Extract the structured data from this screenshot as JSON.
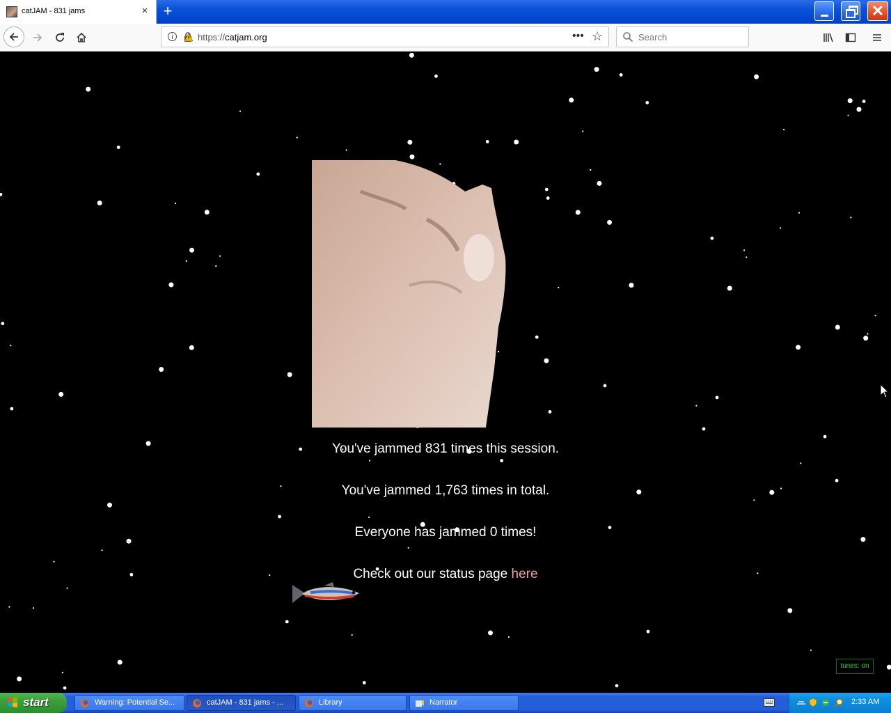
{
  "browser": {
    "tab_title": "catJAM - 831 jams",
    "close_tab": "×",
    "new_tab": "+",
    "url_prefix": "https://",
    "url_domain": "catjam.org",
    "page_actions": "•••",
    "bookmark_star": "☆",
    "search_placeholder": "Search"
  },
  "page": {
    "line_session_pre": "You've jammed ",
    "session_count": "831",
    "line_session_post": " times this session.",
    "line_total_pre": "You've jammed ",
    "total_count": "1,763",
    "line_total_post": " times in total.",
    "line_everyone": "Everyone has jammed 0 times!",
    "status_text": "Check out our status page ",
    "status_link": "here",
    "tunes_toggle": "tunes: on",
    "colors": {
      "background": "#000000",
      "text": "#ffffff",
      "link": "#f59bb0",
      "tunes": "#28d428"
    }
  },
  "taskbar": {
    "start_label": "start",
    "tasks": [
      {
        "label": "Warning: Potential Se...",
        "icon": "firefox-icon"
      },
      {
        "label": "catJAM - 831 jams - ...",
        "icon": "firefox-icon"
      },
      {
        "label": "Library",
        "icon": "firefox-icon"
      },
      {
        "label": "Narrator",
        "icon": "narrator-icon"
      }
    ],
    "clock": "2:33 AM"
  }
}
